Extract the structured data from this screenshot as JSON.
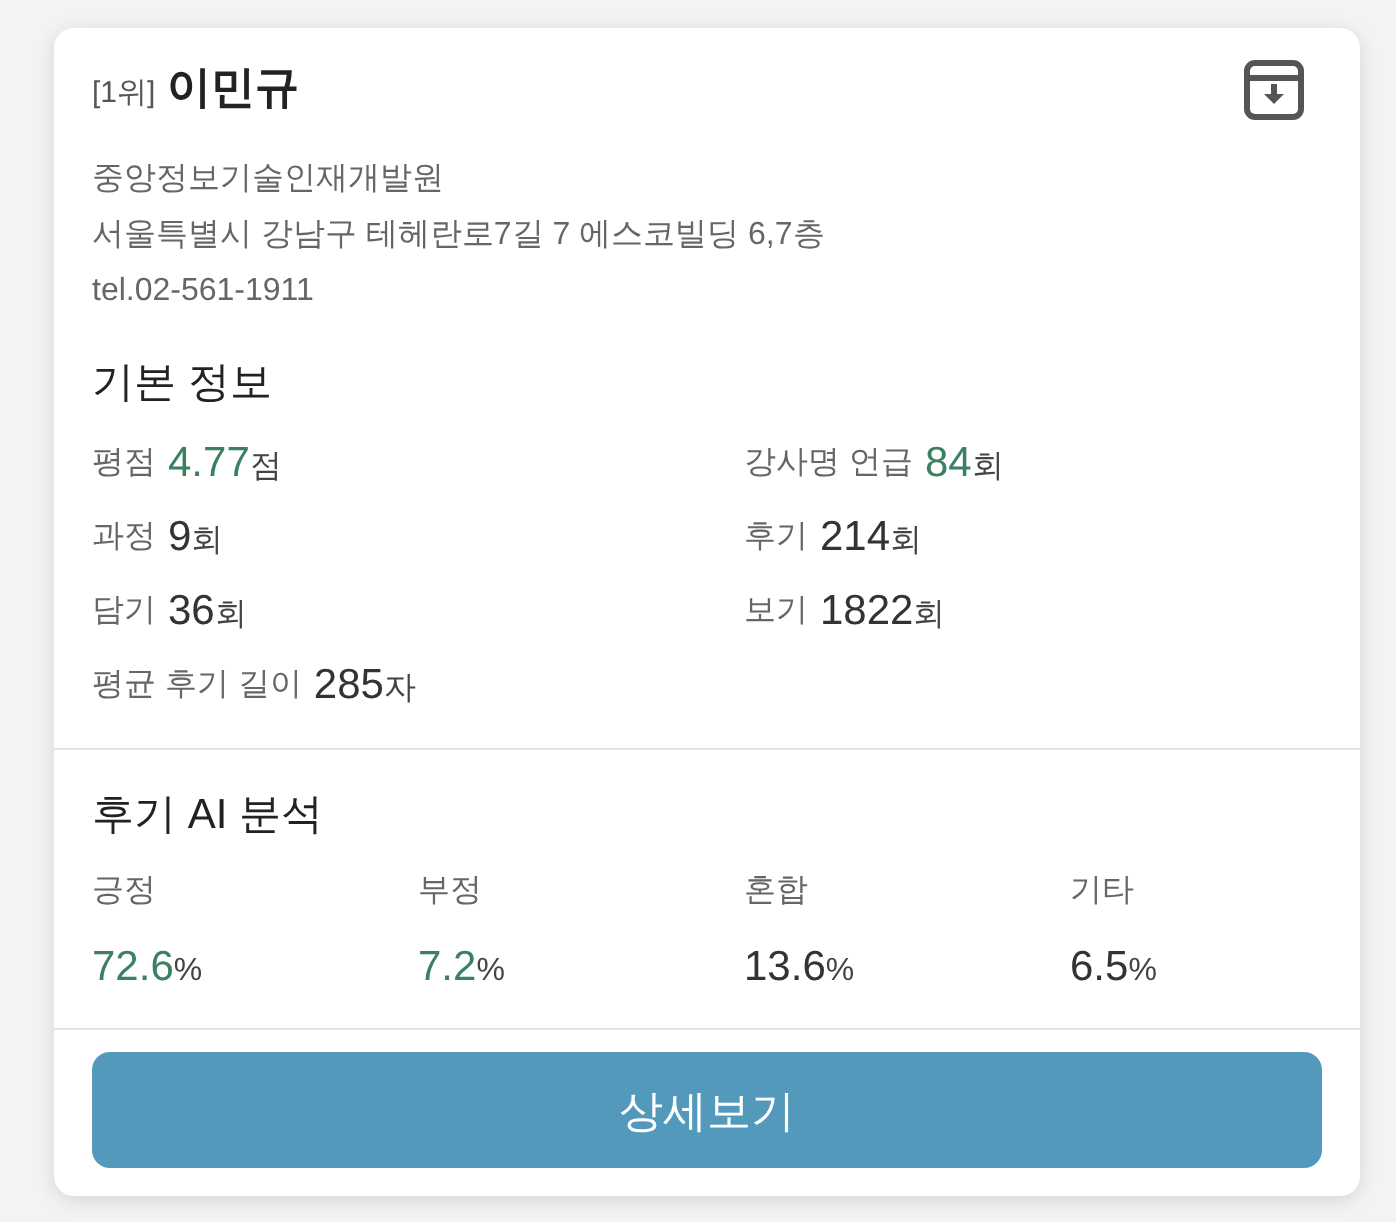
{
  "card": {
    "rank": "[1위]",
    "name": "이민규",
    "address_lines": [
      "중앙정보기술인재개발원",
      "서울특별시 강남구 테헤란로7길 7 에스코빌딩 6,7층",
      "tel.02-561-1911"
    ]
  },
  "basic_info": {
    "title": "기본 정보",
    "stats": [
      {
        "label": "평점",
        "value": "4.77",
        "unit": "점",
        "highlighted": true
      },
      {
        "label": "강사명 언급",
        "value": "84",
        "unit": "회",
        "highlighted": true
      },
      {
        "label": "과정",
        "value": "9",
        "unit": "회",
        "highlighted": false
      },
      {
        "label": "후기",
        "value": "214",
        "unit": "회",
        "highlighted": false
      },
      {
        "label": "담기",
        "value": "36",
        "unit": "회",
        "highlighted": false
      },
      {
        "label": "보기",
        "value": "1822",
        "unit": "회",
        "highlighted": false
      },
      {
        "label": "평균 후기 길이",
        "value": "285",
        "unit": "자",
        "highlighted": false
      }
    ]
  },
  "review_analysis": {
    "title": "후기 AI 분석",
    "items": [
      {
        "label": "긍정",
        "value": "72.6",
        "unit": "%",
        "highlighted": true
      },
      {
        "label": "부정",
        "value": "7.2",
        "unit": "%",
        "highlighted": true
      },
      {
        "label": "혼합",
        "value": "13.6",
        "unit": "%",
        "highlighted": false
      },
      {
        "label": "기타",
        "value": "6.5",
        "unit": "%",
        "highlighted": false
      }
    ]
  },
  "detail_button": {
    "label": "상세보기"
  }
}
